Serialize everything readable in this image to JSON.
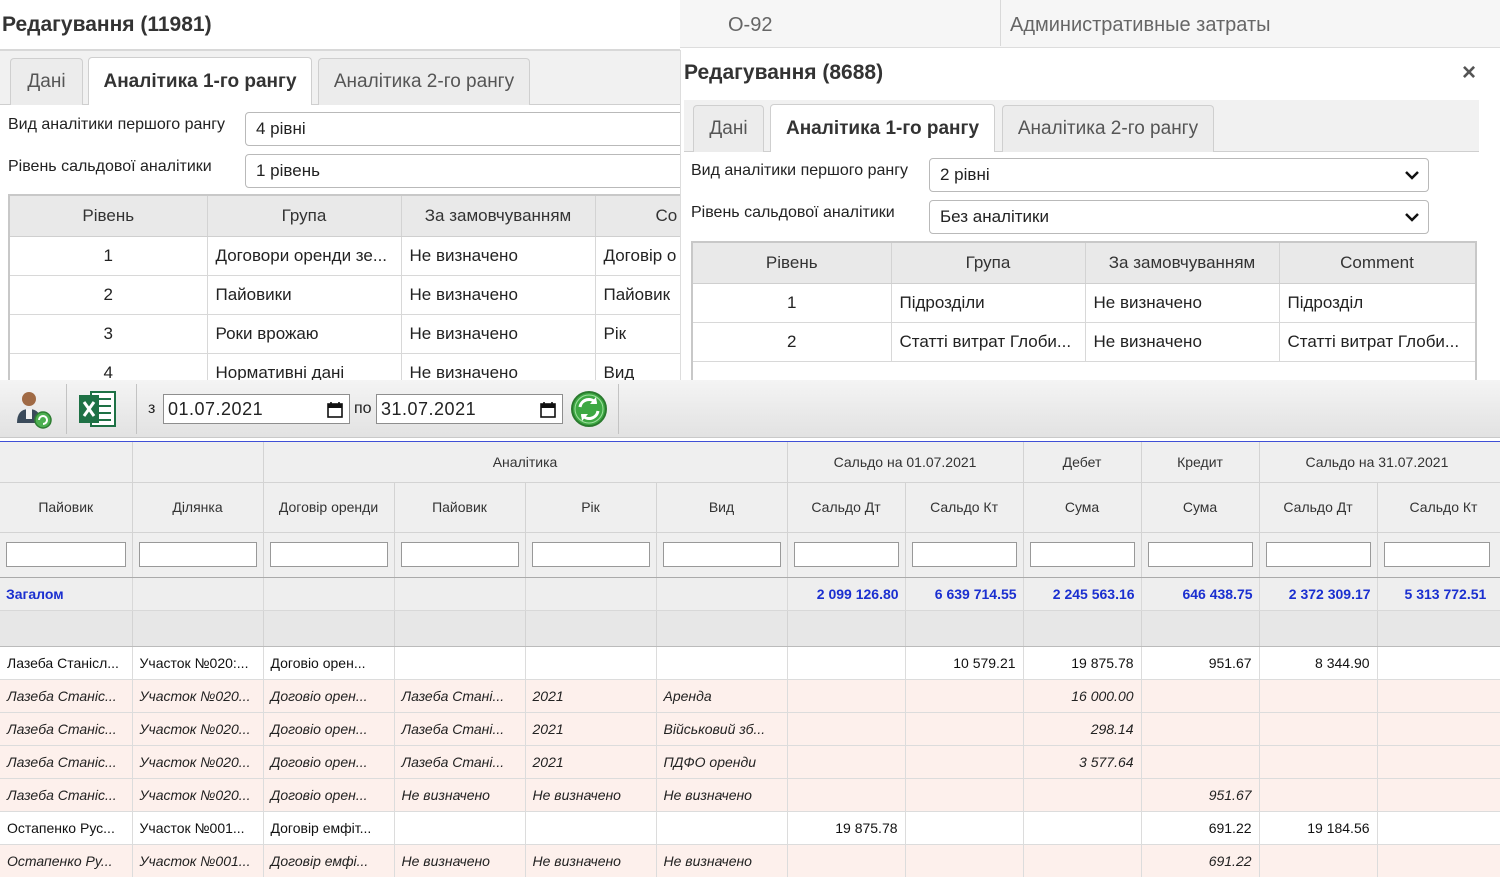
{
  "bg_strip": {
    "code": "О-92",
    "name": "Административные затраты"
  },
  "dialog1": {
    "title": "Редагування (11981)",
    "tabs": [
      "Дані",
      "Аналітика 1-го рангу",
      "Аналітика 2-го рангу"
    ],
    "active_tab": 1,
    "field1_label": "Вид аналітики першого рангу",
    "field1_value": "4 рівні",
    "field2_label": "Рівень сальдової аналітики",
    "field2_value": "1 рівень",
    "grid": {
      "headers": [
        "Рівень",
        "Група",
        "За замовчуванням",
        "Co"
      ],
      "rows": [
        [
          "1",
          "Договори оренди зе...",
          "Не визначено",
          "Договір о"
        ],
        [
          "2",
          "Пайовики",
          "Не визначено",
          "Пайовик"
        ],
        [
          "3",
          "Роки врожаю",
          "Не визначено",
          "Рік"
        ],
        [
          "4",
          "Нормативні дані",
          "Не визначено",
          "Вид"
        ]
      ]
    }
  },
  "dialog2": {
    "title": "Редагування (8688)",
    "close": "×",
    "tabs": [
      "Дані",
      "Аналітика 1-го рангу",
      "Аналітика 2-го рангу"
    ],
    "active_tab": 1,
    "field1_label": "Вид аналітики першого рангу",
    "field1_value": "2 рівні",
    "field2_label": "Рівень сальдової аналітики",
    "field2_value": "Без аналітики",
    "grid": {
      "headers": [
        "Рівень",
        "Група",
        "За замовчуванням",
        "Comment"
      ],
      "rows": [
        [
          "1",
          "Підрозділи",
          "Не визначено",
          "Підрозділ"
        ],
        [
          "2",
          "Статті витрат Глоби...",
          "Не визначено",
          "Статті витрат Глоби..."
        ]
      ]
    }
  },
  "toolbar": {
    "from_label": "з",
    "from_date": "01.07.2021",
    "to_label": "по",
    "to_date": "31.07.2021",
    "icons": [
      "users-refresh-icon",
      "excel-icon",
      "refresh-icon"
    ]
  },
  "main": {
    "group_headers": [
      "Аналітика",
      "Сальдо на 01.07.2021",
      "Дебет",
      "Кредит",
      "Сальдо на 31.07.2021"
    ],
    "columns": [
      "Пайовик",
      "Ділянка",
      "Договір оренди",
      "Пайовик",
      "Рік",
      "Вид",
      "Сальдо Дт",
      "Сальдо Кт",
      "Сума",
      "Сума",
      "Сальдо Дт",
      "Сальдо Кт"
    ],
    "total": {
      "label": "Загалом",
      "values": [
        "2 099 126.80",
        "6 639 714.55",
        "2 245 563.16",
        "646 438.75",
        "2 372 309.17",
        "5 313 772.51"
      ]
    },
    "rows": [
      {
        "sub": false,
        "cells": [
          "Лазеба Станісл...",
          "Участок №020:...",
          "Договіо орен...",
          "",
          "",
          "",
          "",
          "10 579.21",
          "19 875.78",
          "951.67",
          "8 344.90",
          ""
        ]
      },
      {
        "sub": true,
        "cells": [
          "Лазеба Станіс...",
          "Участок №020...",
          "Договіо орен...",
          "Лазеба Стані...",
          "2021",
          "Аренда",
          "",
          "",
          "16 000.00",
          "",
          "",
          ""
        ]
      },
      {
        "sub": true,
        "cells": [
          "Лазеба Станіс...",
          "Участок №020...",
          "Договіо орен...",
          "Лазеба Стані...",
          "2021",
          "Військовий зб...",
          "",
          "",
          "298.14",
          "",
          "",
          ""
        ]
      },
      {
        "sub": true,
        "cells": [
          "Лазеба Станіс...",
          "Участок №020...",
          "Договіо орен...",
          "Лазеба Стані...",
          "2021",
          "ПДФО оренди",
          "",
          "",
          "3 577.64",
          "",
          "",
          ""
        ]
      },
      {
        "sub": true,
        "cells": [
          "Лазеба Станіс...",
          "Участок №020...",
          "Договіо орен...",
          "Не визначено",
          "Не визначено",
          "Не визначено",
          "",
          "",
          "",
          "951.67",
          "",
          ""
        ]
      },
      {
        "sub": false,
        "cells": [
          "Остапенко Рус...",
          "Участок №001...",
          "Договір емфіт...",
          "",
          "",
          "",
          "19 875.78",
          "",
          "",
          "691.22",
          "19 184.56",
          ""
        ]
      },
      {
        "sub": true,
        "cells": [
          "Остапенко Ру...",
          "Участок №001...",
          "Договір емфі...",
          "Не визначено",
          "Не визначено",
          "Не визначено",
          "",
          "",
          "",
          "691.22",
          "",
          ""
        ]
      }
    ]
  }
}
